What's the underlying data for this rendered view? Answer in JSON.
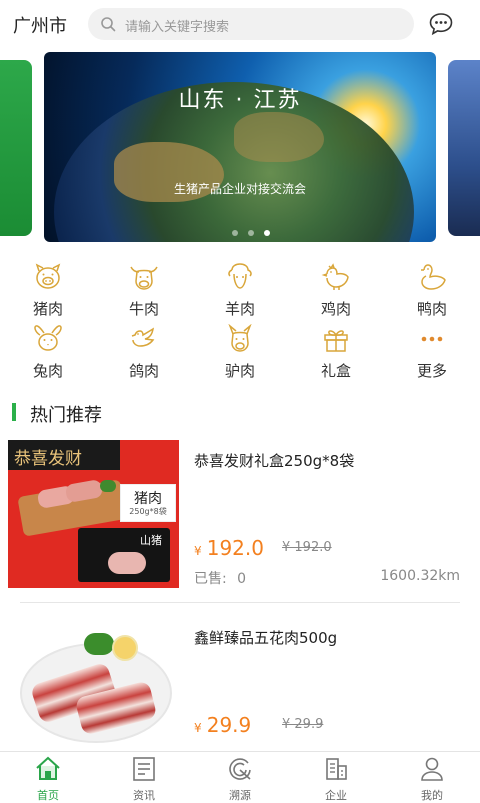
{
  "header": {
    "city": "广州市",
    "search_placeholder": "请输入关键字搜索"
  },
  "banner": {
    "title": "山东 · 江苏",
    "subtitle": "生猪产品企业对接交流会",
    "slide_count": 3,
    "active_slide": 3
  },
  "categories": [
    {
      "label": "猪肉",
      "icon": "pig-icon"
    },
    {
      "label": "牛肉",
      "icon": "cow-icon"
    },
    {
      "label": "羊肉",
      "icon": "sheep-icon"
    },
    {
      "label": "鸡肉",
      "icon": "chicken-icon"
    },
    {
      "label": "鸭肉",
      "icon": "duck-icon"
    },
    {
      "label": "兔肉",
      "icon": "rabbit-icon"
    },
    {
      "label": "鸽肉",
      "icon": "pigeon-icon"
    },
    {
      "label": "驴肉",
      "icon": "donkey-icon"
    },
    {
      "label": "礼盒",
      "icon": "gift-icon"
    },
    {
      "label": "更多",
      "icon": "more-icon"
    }
  ],
  "section": {
    "title": "热门推荐"
  },
  "products": [
    {
      "name": "恭喜发财礼盒250g*8袋",
      "currency": "¥",
      "price": "192.0",
      "original_price": "¥ 192.0",
      "sold_label": "已售:",
      "sold": "0",
      "distance": "1600.32km",
      "banner_text": "恭喜发财",
      "tag_text": "猪肉",
      "tag_sub": "250g*8袋",
      "box_logo": "山猪"
    },
    {
      "name": "鑫鲜臻品五花肉500g",
      "currency": "¥",
      "price": "29.9",
      "original_price": "¥ 29.9"
    }
  ],
  "tabs": [
    {
      "label": "首页",
      "icon": "home-icon",
      "active": true
    },
    {
      "label": "资讯",
      "icon": "news-icon",
      "active": false
    },
    {
      "label": "溯源",
      "icon": "trace-icon",
      "active": false
    },
    {
      "label": "企业",
      "icon": "company-icon",
      "active": false
    },
    {
      "label": "我的",
      "icon": "user-icon",
      "active": false
    }
  ],
  "colors": {
    "accent": "#2aa54a",
    "price": "#f3801f",
    "icon_gold": "#d9a63a"
  }
}
